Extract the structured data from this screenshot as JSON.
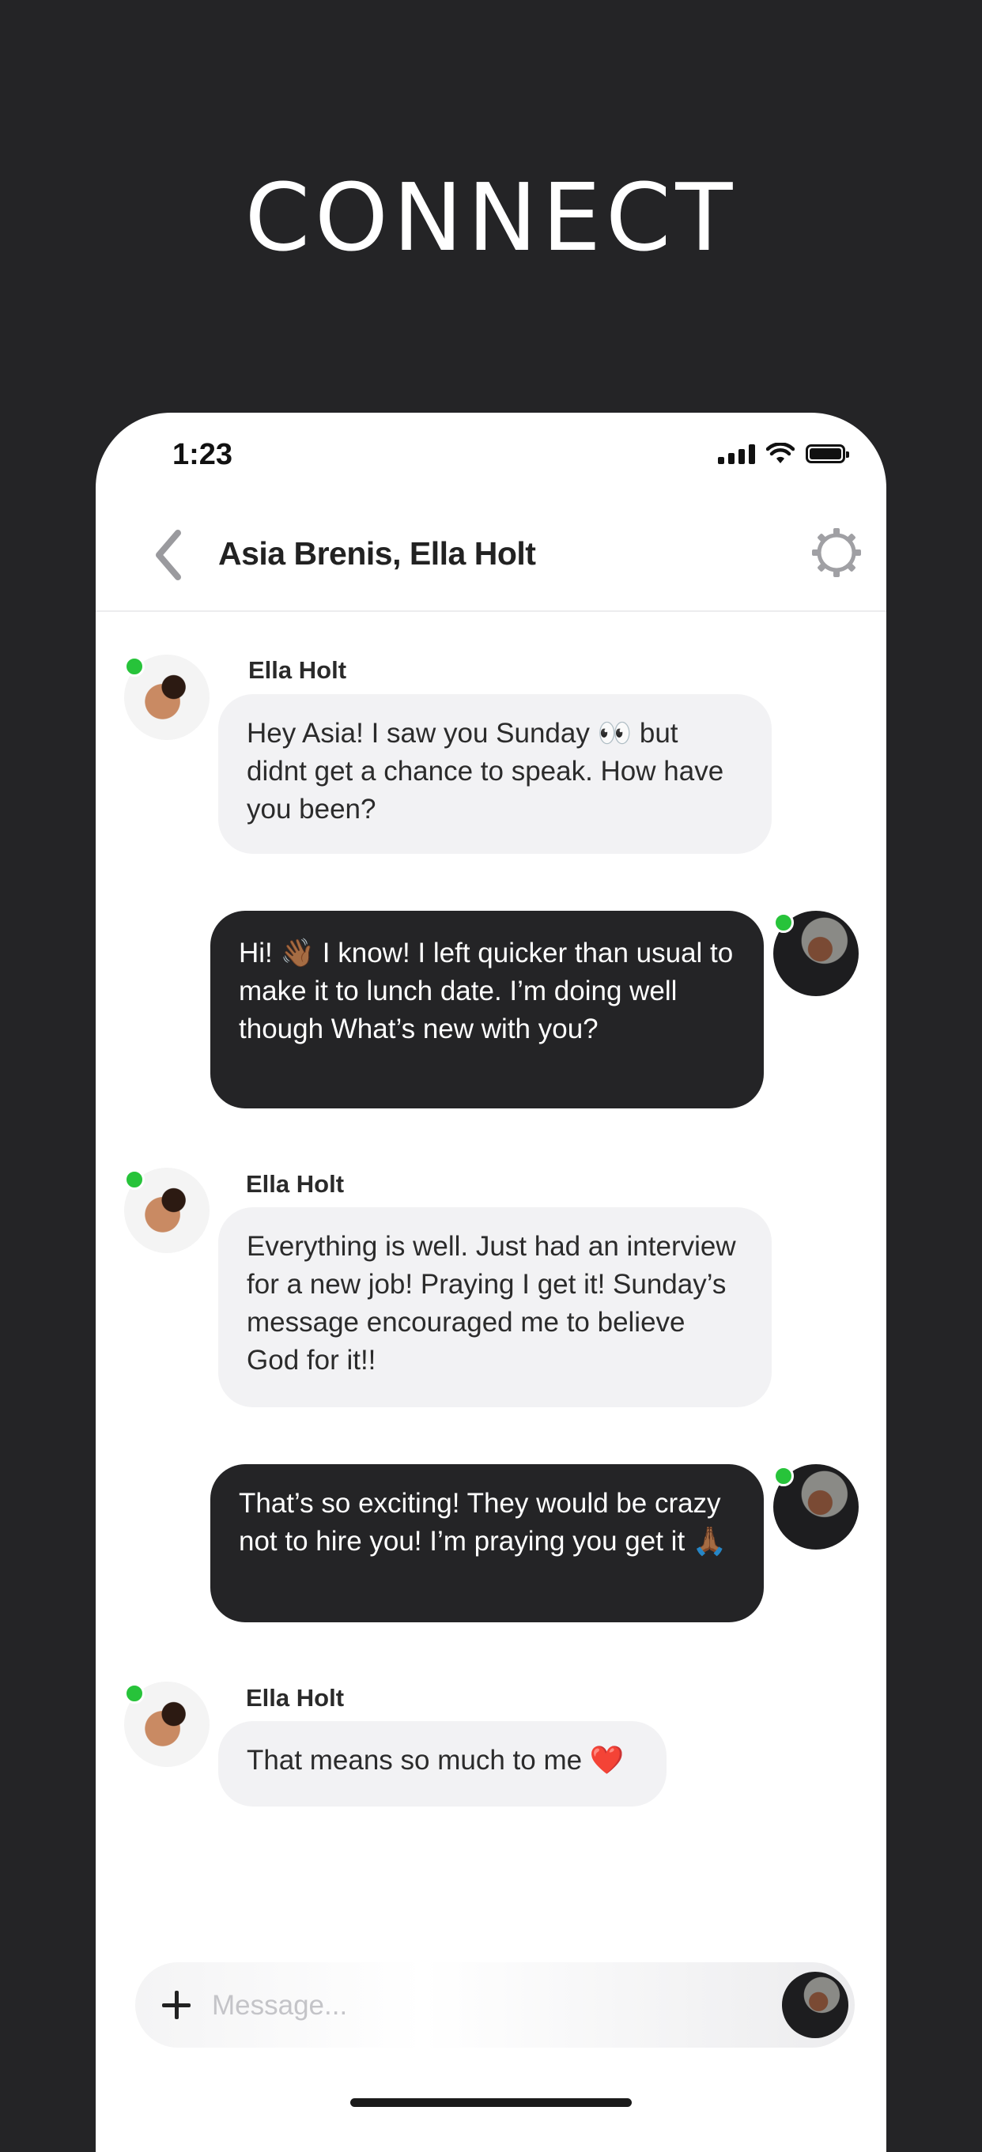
{
  "hero": {
    "title": "CONNECT"
  },
  "status_bar": {
    "time": "1:23"
  },
  "header": {
    "title": "Asia Brenis, Ella Holt"
  },
  "messages": [
    {
      "sender": "Ella Holt",
      "direction": "incoming",
      "text": "Hey Asia! I saw you Sunday 👀 but didnt get a chance to speak. How have you been?"
    },
    {
      "sender": "",
      "direction": "outgoing",
      "text": "Hi! 👋🏾 I know! I left quicker than usual to make it to lunch date. I’m doing well though What’s new with you?"
    },
    {
      "sender": "Ella Holt",
      "direction": "incoming",
      "text": "Everything is well. Just had an interview for a new job! Praying I get it! Sunday’s message encouraged me to believe God for it!!"
    },
    {
      "sender": "",
      "direction": "outgoing",
      "text": "That’s so exciting! They would be crazy not to hire you! I’m praying you get it 🙏🏾"
    },
    {
      "sender": "Ella Holt",
      "direction": "incoming",
      "text": "That means so much to me ❤️"
    }
  ],
  "composer": {
    "placeholder": "Message..."
  },
  "colors": {
    "background": "#242426",
    "online": "#27c33a",
    "incoming_bubble": "#f2f2f4",
    "outgoing_bubble": "#242426"
  },
  "icons": {
    "back": "chevron-left-icon",
    "settings": "gear-icon",
    "add": "plus-icon"
  }
}
